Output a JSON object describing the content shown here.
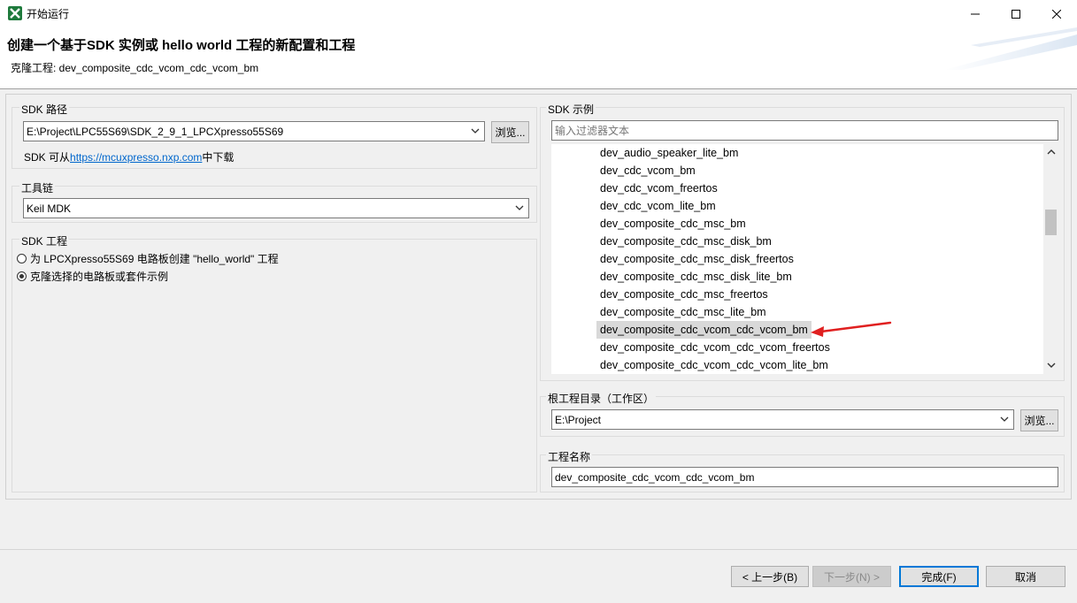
{
  "window": {
    "title": "开始运行",
    "controls": {
      "minimize": "minimize-icon",
      "maximize": "maximize-icon",
      "close": "close-icon"
    }
  },
  "header": {
    "heading": "创建一个基于SDK 实例或 hello world 工程的新配置和工程",
    "subtitle": "克隆工程: dev_composite_cdc_vcom_cdc_vcom_bm"
  },
  "sdk_path": {
    "label": "SDK 路径",
    "value": "E:\\Project\\LPC55S69\\SDK_2_9_1_LPCXpresso55S69",
    "browse": "浏览...",
    "note_prefix": "SDK 可从",
    "note_link": "https://mcuxpresso.nxp.com",
    "note_suffix": "中下载"
  },
  "toolchain": {
    "label": "工具链",
    "value": "Keil MDK"
  },
  "sdk_project": {
    "label": "SDK 工程",
    "option1": "为 LPCXpresso55S69 电路板创建 \"hello_world\" 工程",
    "option2": "克隆选择的电路板或套件示例",
    "selected": "option2"
  },
  "sdk_examples": {
    "label": "SDK 示例",
    "filter_placeholder": "输入过滤器文本",
    "items": [
      "dev_audio_speaker_lite_bm",
      "dev_cdc_vcom_bm",
      "dev_cdc_vcom_freertos",
      "dev_cdc_vcom_lite_bm",
      "dev_composite_cdc_msc_bm",
      "dev_composite_cdc_msc_disk_bm",
      "dev_composite_cdc_msc_disk_freertos",
      "dev_composite_cdc_msc_disk_lite_bm",
      "dev_composite_cdc_msc_freertos",
      "dev_composite_cdc_msc_lite_bm",
      "dev_composite_cdc_vcom_cdc_vcom_bm",
      "dev_composite_cdc_vcom_cdc_vcom_freertos",
      "dev_composite_cdc_vcom_cdc_vcom_lite_bm"
    ],
    "selected_index": 10
  },
  "root_dir": {
    "label": "根工程目录（工作区）",
    "value": "E:\\Project",
    "browse": "浏览..."
  },
  "project_name": {
    "label": "工程名称",
    "value": "dev_composite_cdc_vcom_cdc_vcom_bm"
  },
  "buttons": {
    "back": "< 上一步(B)",
    "next": "下一步(N) >",
    "finish": "完成(F)",
    "cancel": "取消"
  },
  "colors": {
    "link": "#0066cc",
    "accent_border": "#0078d7",
    "annotation_arrow": "#e02020",
    "selection": "#d9d9d9"
  }
}
